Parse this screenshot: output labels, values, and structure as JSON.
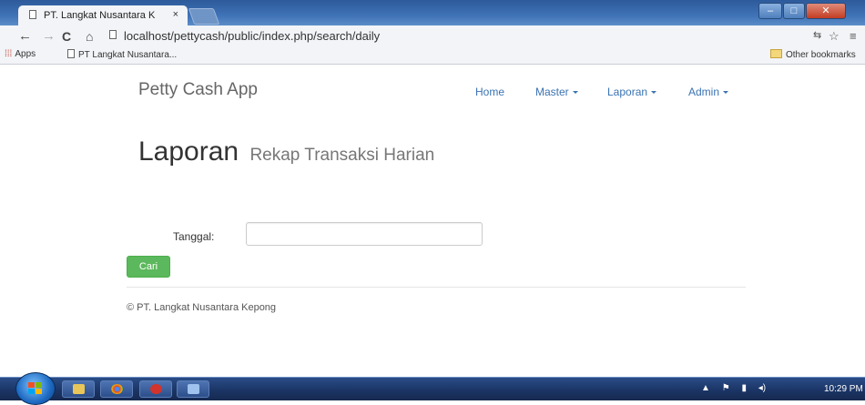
{
  "browser": {
    "tab_title": "PT. Langkat Nusantara K",
    "tab_close": "×",
    "address": "localhost/pettycash/public/index.php/search/daily",
    "window_controls": {
      "minimize": "–",
      "maximize": "□",
      "close": "✕"
    },
    "nav": {
      "back": "←",
      "forward": "→",
      "reload": "C",
      "home": "⌂"
    },
    "toolbar_icons": {
      "translate": "⇆",
      "star": "☆",
      "menu": "≡"
    },
    "bookmarks": {
      "apps": "Apps",
      "apps_icon": "⁞⁞⁞",
      "pt": "PT Langkat Nusantara...",
      "other": "Other bookmarks"
    }
  },
  "app": {
    "brand": "Petty Cash App",
    "nav": {
      "home": "Home",
      "master": "Master",
      "laporan": "Laporan",
      "admin": "Admin"
    }
  },
  "page": {
    "title": "Laporan",
    "subtitle": "Rekap Transaksi Harian",
    "form": {
      "date_label": "Tanggal:",
      "date_value": "",
      "submit_label": "Cari"
    },
    "footer": "© PT. Langkat Nusantara Kepong"
  },
  "taskbar": {
    "tray_icons": [
      "▲",
      "⚑",
      "▮",
      "◂)"
    ],
    "clock": "10:29 PM"
  },
  "colors": {
    "accent_link": "#3a73b3",
    "success_button": "#5cb85c",
    "titlebar": "#3f72b6",
    "taskbar": "#1b3566"
  }
}
